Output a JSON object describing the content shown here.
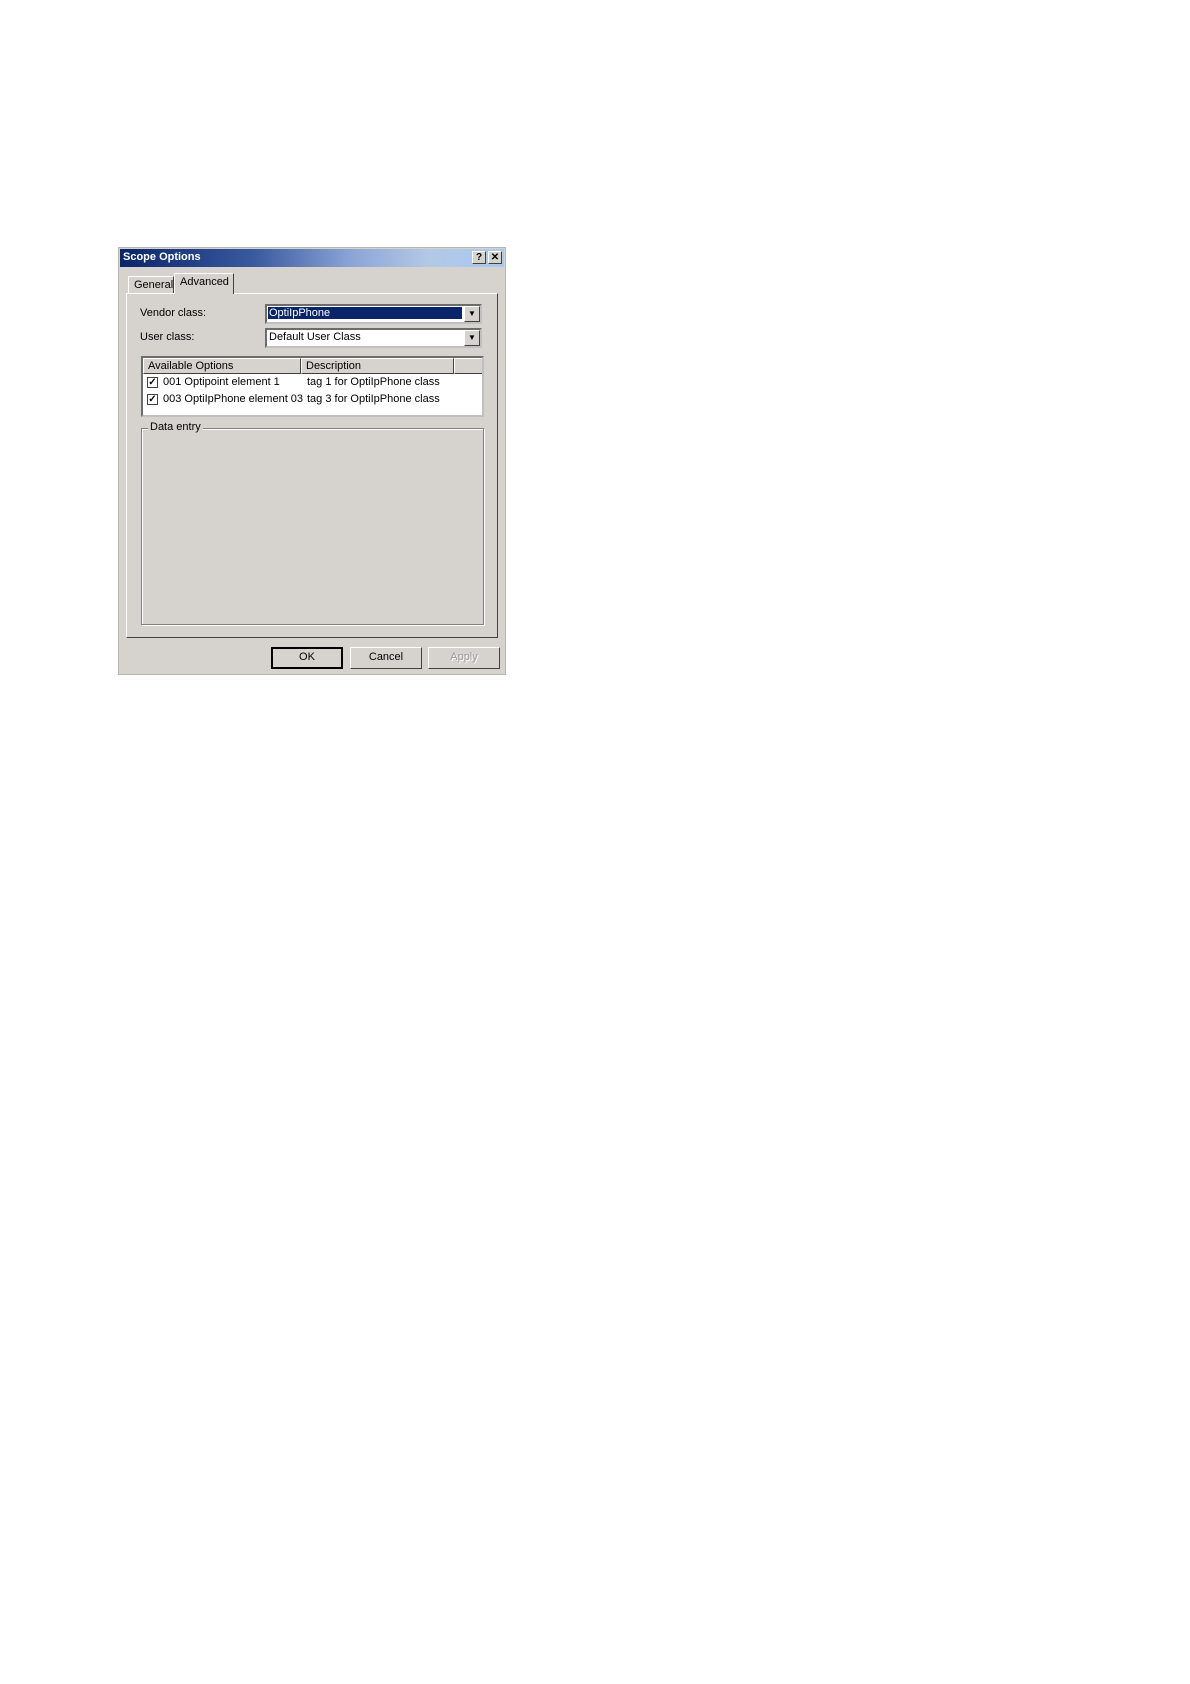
{
  "window": {
    "title": "Scope Options",
    "help_button": "?",
    "close_button": "✕"
  },
  "tabs": [
    {
      "label": "General"
    },
    {
      "label": "Advanced"
    }
  ],
  "form": {
    "vendor_class_label": "Vendor class:",
    "vendor_class_value": "OptiIpPhone",
    "user_class_label": "User class:",
    "user_class_value": "Default User Class"
  },
  "options_list": {
    "columns": [
      "Available Options",
      "Description"
    ],
    "rows": [
      {
        "checked": true,
        "option": "001 Optipoint element 1",
        "description": "tag 1 for OptiIpPhone class"
      },
      {
        "checked": true,
        "option": "003 OptiIpPhone element 03",
        "description": "tag 3 for OptiIpPhone class"
      }
    ]
  },
  "data_entry": {
    "label": "Data entry"
  },
  "buttons": {
    "ok": "OK",
    "cancel": "Cancel",
    "apply": "Apply"
  }
}
